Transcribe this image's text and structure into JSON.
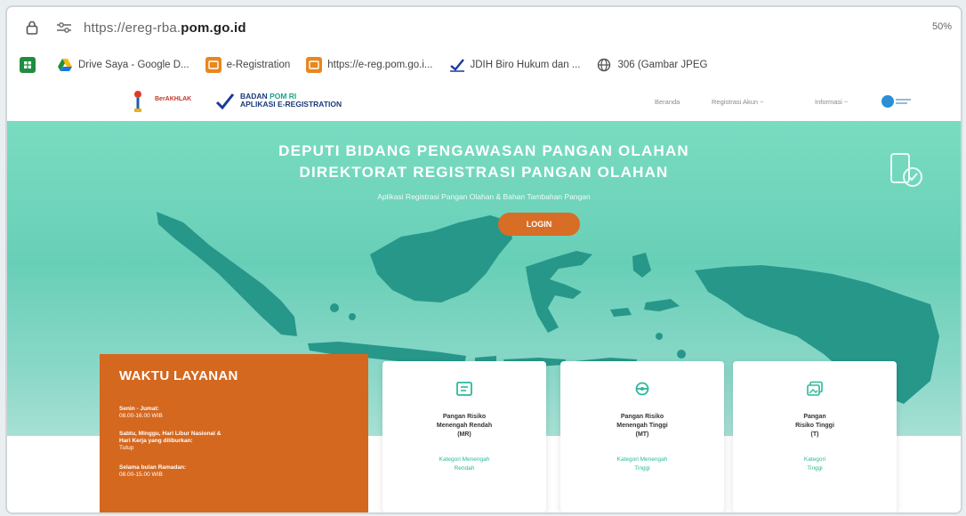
{
  "browser": {
    "url_prefix": "https://ereg-rba.",
    "url_domain": "pom.go.id",
    "zoom": "50%"
  },
  "bookmarks": [
    {
      "label": "",
      "icon": "sheets-icon",
      "color": "#1e8e3e"
    },
    {
      "label": "Drive Saya - Google D...",
      "icon": "drive-icon",
      "color": "#1a73e8"
    },
    {
      "label": "e-Registration",
      "icon": "ereg-icon",
      "color": "#e8871e"
    },
    {
      "label": "https://e-reg.pom.go.i...",
      "icon": "ereg-icon",
      "color": "#e8871e"
    },
    {
      "label": "JDIH Biro Hukum dan ...",
      "icon": "check-logo-icon",
      "color": "#1a3a9a"
    },
    {
      "label": "306 (Gambar JPEG",
      "icon": "globe-icon",
      "color": "#555555"
    }
  ],
  "site": {
    "brand_small": "BerAKHLAK",
    "logo_line1_a": "BADAN ",
    "logo_line1_b": "POM RI",
    "logo_line2": "APLIKASI E-REGISTRATION",
    "nav": [
      "Beranda",
      "Registrasi Akun ~",
      "Informasi ~"
    ]
  },
  "hero": {
    "title1": "DEPUTI BIDANG PENGAWASAN PANGAN OLAHAN",
    "title2": "DIREKTORAT REGISTRASI PANGAN OLAHAN",
    "subtitle": "Aplikasi Registrasi Pangan Olahan & Bahan Tambahan Pangan",
    "login": "LOGIN"
  },
  "waktu": {
    "title": "WAKTU LAYANAN",
    "b1_h": "Senin - Jumat:",
    "b1_v": "08.00-16.00 WIB",
    "b2_h": "Sabtu, Minggu, Hari Libur Nasional &",
    "b2_h2": "Hari Kerja yang diliburkan:",
    "b2_v": "Tutup",
    "b3_h": "Selama bulan Ramadan:",
    "b3_v": "08.00-15.00 WIB"
  },
  "cards": [
    {
      "line1": "Pangan Risiko",
      "line2": "Menengah Rendah",
      "line3": "(MR)",
      "cat1": "Kategori Menengah",
      "cat2": "Rendah",
      "icon": "document-icon"
    },
    {
      "line1": "Pangan Risiko",
      "line2": "Menengah Tinggi",
      "line3": "(MT)",
      "cat1": "Kategori Menengah",
      "cat2": "Tinggi",
      "icon": "cog-icon"
    },
    {
      "line1": "Pangan",
      "line2": "Risiko Tinggi",
      "line3": "(T)",
      "cat1": "Kategori",
      "cat2": "Tinggi",
      "icon": "image-stack-icon"
    }
  ],
  "colors": {
    "hero": "#6fd4bb",
    "map": "#27978a",
    "accent_orange": "#d4681f",
    "card_category": "#2fb79c"
  }
}
